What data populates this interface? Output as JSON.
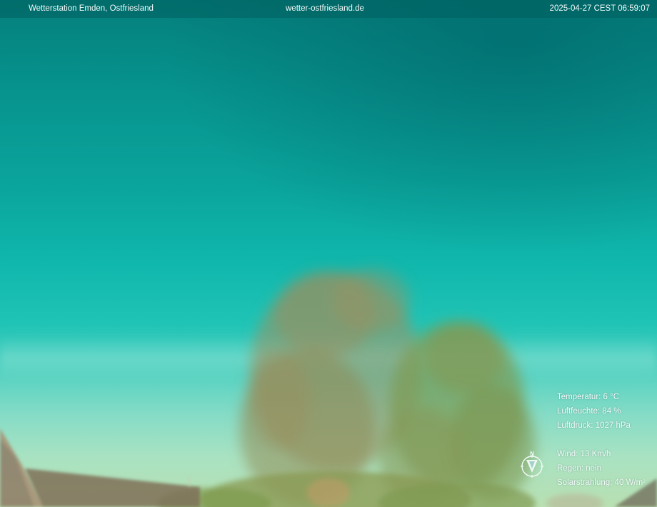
{
  "overlay": {
    "station": "Wetterstation Emden, Ostfriesland",
    "site": "wetter-ostfriesland.de",
    "timestamp": "2025-04-27 CEST 06:59:07"
  },
  "readings": {
    "temperature": "Temperatur: 6 °C",
    "humidity": "Luftfeuchte: 84 %",
    "pressure": "Luftdruck: 1027 hPa",
    "wind": "Wind: 13 Km/h",
    "rain": "Regen: nein",
    "solar": "Solarstrahlung: 40 W/m²"
  },
  "compass": {
    "north_label": "N",
    "icon": "compass-wind-direction-icon"
  },
  "colors": {
    "sky_top": "#047f7c",
    "sky_mid": "#10b7ac",
    "sky_horizon": "#a8e2c2",
    "foliage": "#8c9b5a",
    "text": "#f2fbf9"
  }
}
